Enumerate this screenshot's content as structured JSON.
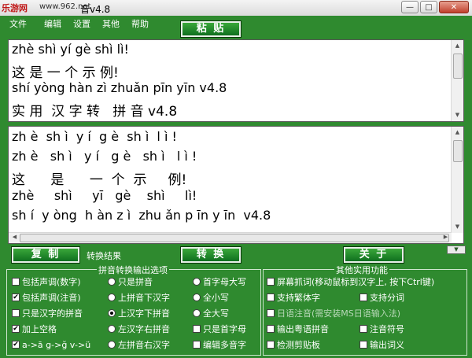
{
  "titlebar": {
    "watermark": "乐游网",
    "watermark_url": "www.962.net",
    "title": "音v4.8",
    "minimize": "—",
    "maximize": "□",
    "close": "✕"
  },
  "menu": [
    "文件",
    "编辑",
    "设置",
    "其他",
    "帮助"
  ],
  "buttons": {
    "paste": "粘 贴",
    "copy": "复 制",
    "convert": "转 换",
    "close": "关 于"
  },
  "input_lines": [
    "zhè shì yí gè shì lì!",
    "这 是 一 个 示 例!",
    "shí yòng hàn zì zhuǎn pīn yīn v4.8",
    "实 用  汉 字 转   拼 音 v4.8"
  ],
  "output_lines": [
    "zh è  sh ì  y í  g è  sh ì  l ì !",
    "zh è   sh ì   y í   g è   sh ì   l ì !",
    "这      是      一  个  示     例!",
    "zhè     shì     yī   gè    shì     lì!",
    "sh í  y òng  h àn z ì  zhu ǎn p īn y īn  v4.8"
  ],
  "result_label": "转换结果",
  "pinyin_group": {
    "title": "拼音转换输出选项",
    "col1": [
      {
        "label": "包括声调(数字)",
        "checked": false
      },
      {
        "label": "包括声调(注音)",
        "checked": true
      },
      {
        "label": "只是汉字的拼音",
        "checked": false
      },
      {
        "label": "加上空格",
        "checked": true
      },
      {
        "label": "a->ā g->ğ v->ü",
        "checked": true
      }
    ],
    "col2": [
      {
        "label": "只是拼音",
        "selected": false
      },
      {
        "label": "上拼音下汉字",
        "selected": false
      },
      {
        "label": "上汉字下拼音",
        "selected": true
      },
      {
        "label": "左汉字右拼音",
        "selected": false
      },
      {
        "label": "左拼音右汉字",
        "selected": false
      }
    ],
    "col3": [
      {
        "label": "首字母大写",
        "selected": false
      },
      {
        "label": "全小写",
        "selected": false
      },
      {
        "label": "全大写",
        "selected": false
      },
      {
        "label": "只是首字母",
        "checked": false
      },
      {
        "label": "编辑多音字",
        "checked": false
      }
    ]
  },
  "other_group": {
    "title": "其他实用功能",
    "items": [
      {
        "label": "屏幕抓词(移动鼠标到汉字上, 按下Ctrl键)",
        "checked": false
      },
      {
        "label": "支持繁体字",
        "checked": false
      },
      {
        "label": "支持分词",
        "checked": false
      },
      {
        "label": "日语注音(需安装MS日语输入法)",
        "checked": false
      },
      {
        "label": "输出粤语拼音",
        "checked": false
      },
      {
        "label": "注音符号",
        "checked": false
      },
      {
        "label": "检测剪贴板",
        "checked": false
      },
      {
        "label": "输出词义",
        "checked": false
      }
    ]
  },
  "corner_arrow": "▼"
}
